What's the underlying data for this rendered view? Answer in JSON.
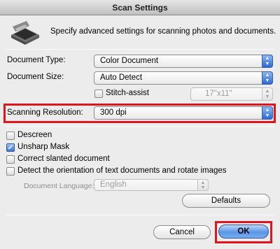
{
  "window": {
    "title": "Scan Settings"
  },
  "header": {
    "description": "Specify advanced settings for scanning photos and documents."
  },
  "fields": {
    "document_type": {
      "label": "Document Type:",
      "value": "Color Document"
    },
    "document_size": {
      "label": "Document Size:",
      "value": "Auto Detect"
    },
    "stitch_assist": {
      "label": "Stitch-assist",
      "checked": false,
      "size_value": "17\"x11\""
    },
    "scanning_resolution": {
      "label": "Scanning Resolution:",
      "value": "300 dpi"
    }
  },
  "options": {
    "descreen": {
      "label": "Descreen",
      "checked": false
    },
    "unsharp_mask": {
      "label": "Unsharp Mask",
      "checked": true
    },
    "correct_slanted": {
      "label": "Correct slanted document",
      "checked": false
    },
    "detect_orientation": {
      "label": "Detect the orientation of text documents and rotate images",
      "checked": false
    },
    "document_language": {
      "label": "Document Language:",
      "value": "English"
    }
  },
  "buttons": {
    "defaults": "Defaults",
    "cancel": "Cancel",
    "ok": "OK"
  },
  "colors": {
    "highlight": "#e0151d",
    "accent_blue": "#3b73d6"
  },
  "icons": {
    "header": "scanner-icon",
    "popup": "double-arrow-icon",
    "check": "checkmark-icon"
  }
}
